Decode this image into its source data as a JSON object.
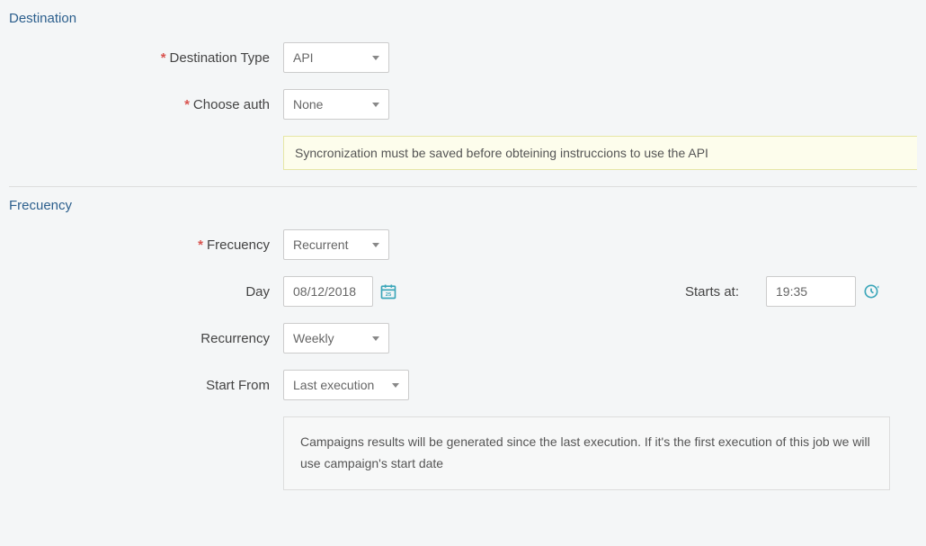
{
  "destination": {
    "section_title": "Destination",
    "type_label": "Destination Type",
    "type_value": "API",
    "auth_label": "Choose auth",
    "auth_value": "None",
    "warning": "Syncronization must be saved before obteining instruccions to use the API"
  },
  "frequency": {
    "section_title": "Frecuency",
    "freq_label": "Frecuency",
    "freq_value": "Recurrent",
    "day_label": "Day",
    "day_value": "08/12/2018",
    "starts_label": "Starts at:",
    "starts_value": "19:35",
    "recurrency_label": "Recurrency",
    "recurrency_value": "Weekly",
    "start_from_label": "Start From",
    "start_from_value": "Last execution",
    "info": "Campaigns results will be generated since the last execution. If it's the first execution of this job we will use campaign's start date"
  }
}
